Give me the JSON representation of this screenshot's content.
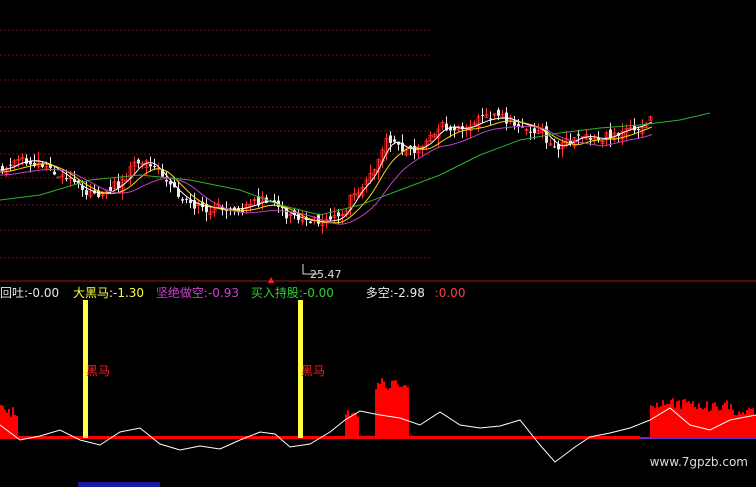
{
  "colors": {
    "background": "#000000",
    "grid": "#7a1010",
    "up_candle": "#ff3030",
    "down_candle": "#e8e8e8",
    "ma_white": "#ffffff",
    "ma_yellow": "#ffd700",
    "ma_purple": "#c040c0",
    "ma_green": "#30b030",
    "bar_yellow": "#ffff40",
    "indicator_red": "#ff0000",
    "indicator_line": "#ffffff",
    "zero_line": "#6a2cc0"
  },
  "price_pane": {
    "low_marker_label": "25.47"
  },
  "indicator_legend": [
    {
      "label": "回吐:",
      "value": "-0.00",
      "color": "#e8e8e8"
    },
    {
      "label": "大黑马:",
      "value": "-1.30",
      "color": "#ffff40"
    },
    {
      "label": "坚绝做空:",
      "value": "-0.93",
      "color": "#d040d0"
    },
    {
      "label": "买入持股:",
      "value": "-0.00",
      "color": "#30d030"
    },
    {
      "label": "多空:",
      "value": "-2.98",
      "color": "#e8e8e8"
    },
    {
      "label": ":",
      "value": "0.00",
      "color": "#ff4040"
    }
  ],
  "signals": [
    {
      "label": "黑马"
    },
    {
      "label": "黑马"
    }
  ],
  "watermark": "www.7gpzb.com"
}
